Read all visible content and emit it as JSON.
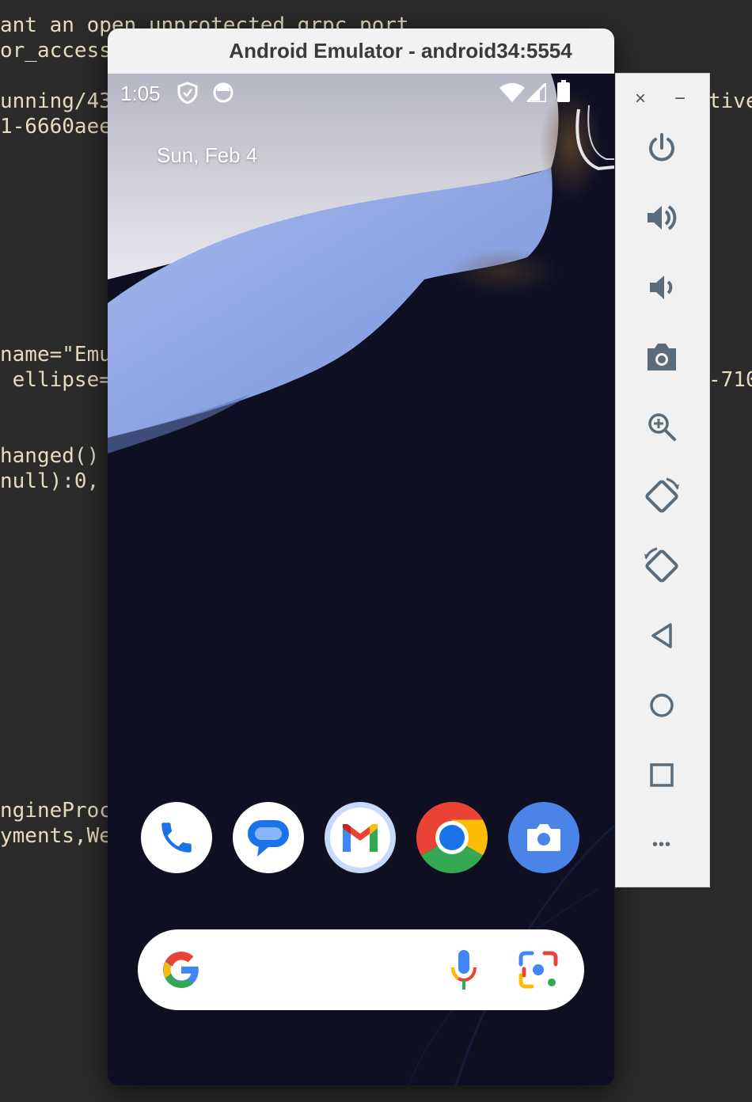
{
  "background_code": {
    "lines": [
      "ant an open unprotected grpc port",
      "or_access",
      "unning/43",
      "1-6660aee",
      "name=\"Emu",
      " ellipse=",
      "hanged()",
      "null):0,",
      "ngineProc",
      "yments,We",
      "tive",
      "-710"
    ]
  },
  "window": {
    "title": "Android Emulator - android34:5554"
  },
  "statusbar": {
    "time": "1:05"
  },
  "homescreen": {
    "date": "Sun, Feb 4",
    "dock_apps": [
      "Phone",
      "Messages",
      "Gmail",
      "Chrome",
      "Camera"
    ]
  },
  "toolbar": {
    "close_glyph": "×",
    "minimize_glyph": "−",
    "buttons": [
      "power",
      "volume-up",
      "volume-down",
      "screenshot",
      "zoom",
      "rotate-left",
      "rotate-right",
      "back",
      "home",
      "overview",
      "more"
    ],
    "more_glyph": "•••"
  },
  "colors": {
    "editor_bg": "#2b2b2b",
    "code_text": "#e8dcc0",
    "toolbar_icon": "#5a6b7a",
    "google_blue": "#4285F4",
    "google_red": "#EA4335",
    "google_yellow": "#FBBC05",
    "google_green": "#34A853"
  }
}
